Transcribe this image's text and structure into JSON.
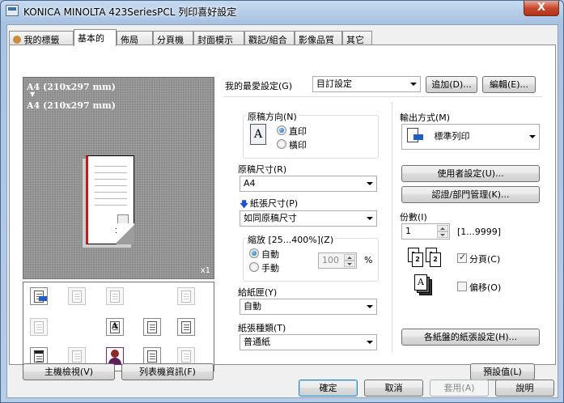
{
  "window": {
    "title": "KONICA MINOLTA 423SeriesPCL 列印喜好設定",
    "close_label": "X"
  },
  "tabs": [
    "我的標籤",
    "基本的",
    "佈局",
    "分頁機",
    "封面模示",
    "戳記/組合",
    "影像品質",
    "其它"
  ],
  "active_tab": 1,
  "preview": {
    "line1": "A4 (210x297 mm)",
    "arrow": "▼",
    "line2": "A4 (210x297 mm)",
    "page_number": "1",
    "copies_mark": "x1"
  },
  "left_buttons": {
    "host_view": "主機檢視(V)",
    "printer_info": "列表機資訊(F)"
  },
  "favorites": {
    "label": "我的最愛設定(G)",
    "value": "目訂設定",
    "add": "追加(D)...",
    "edit": "編輯(E)..."
  },
  "orientation": {
    "label": "原稿方向(N)",
    "portrait": "直印",
    "landscape": "橫印",
    "icon_letter": "A",
    "selected": "portrait"
  },
  "original_size": {
    "label": "原稿尺寸(R)",
    "value": "A4"
  },
  "paper_size": {
    "label": "紙張尺寸(P)",
    "value": "如同原稿尺寸"
  },
  "zoom": {
    "label": "縮放 [25...400%](Z)",
    "auto": "自動",
    "manual": "手動",
    "value": "100",
    "unit": "%",
    "selected": "auto"
  },
  "paper_tray": {
    "label": "給紙匣(Y)",
    "value": "自動"
  },
  "paper_type": {
    "label": "紙張種類(T)",
    "value": "普通紙"
  },
  "output": {
    "label": "輸出方式(M)",
    "value": "標準列印"
  },
  "right_buttons": {
    "user_settings": "使用者設定(U)...",
    "auth": "認證/部門管理(K)...",
    "tray_paper": "各紙盤的紙張設定(H)...",
    "defaults": "預設值(L)"
  },
  "copies": {
    "label": "份數(I)",
    "value": "1",
    "range": "[1...9999]"
  },
  "collate": {
    "label": "分頁(C)",
    "checked": true,
    "icon_digits": [
      "1",
      "2",
      "1",
      "2"
    ]
  },
  "offset": {
    "label": "偏移(O)",
    "checked": false,
    "icon_letter": "A"
  },
  "dialog_buttons": {
    "ok": "確定",
    "cancel": "取消",
    "apply": "套用(A)",
    "help": "說明"
  }
}
